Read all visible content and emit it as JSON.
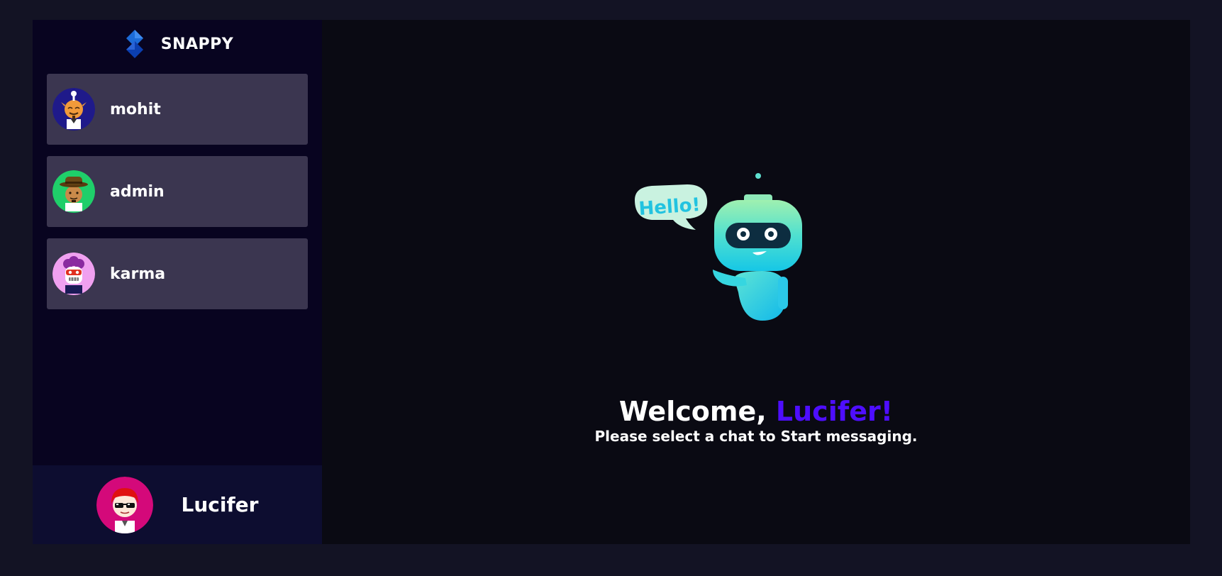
{
  "brand": {
    "name": "SNAPPY",
    "logo_icon": "snappy-logo-icon"
  },
  "contacts": [
    {
      "name": "mohit",
      "avatar_icon": "genie-avatar-icon"
    },
    {
      "name": "admin",
      "avatar_icon": "cowboy-avatar-icon"
    },
    {
      "name": "karma",
      "avatar_icon": "robot-avatar-icon"
    }
  ],
  "current_user": {
    "name": "Lucifer",
    "avatar_icon": "sunglasses-avatar-icon"
  },
  "welcome": {
    "greeting": "Welcome,",
    "username": "Lucifer!",
    "subtitle": "Please select a chat to Start messaging."
  },
  "illustration": {
    "bubble_text": "Hello!"
  },
  "colors": {
    "page_background": "#131324",
    "sidebar_background": "#080420",
    "contact_background": "#3b3650",
    "current_user_background": "#0d0d30",
    "main_background": "#0a0a13",
    "accent": "#4e0eff"
  }
}
